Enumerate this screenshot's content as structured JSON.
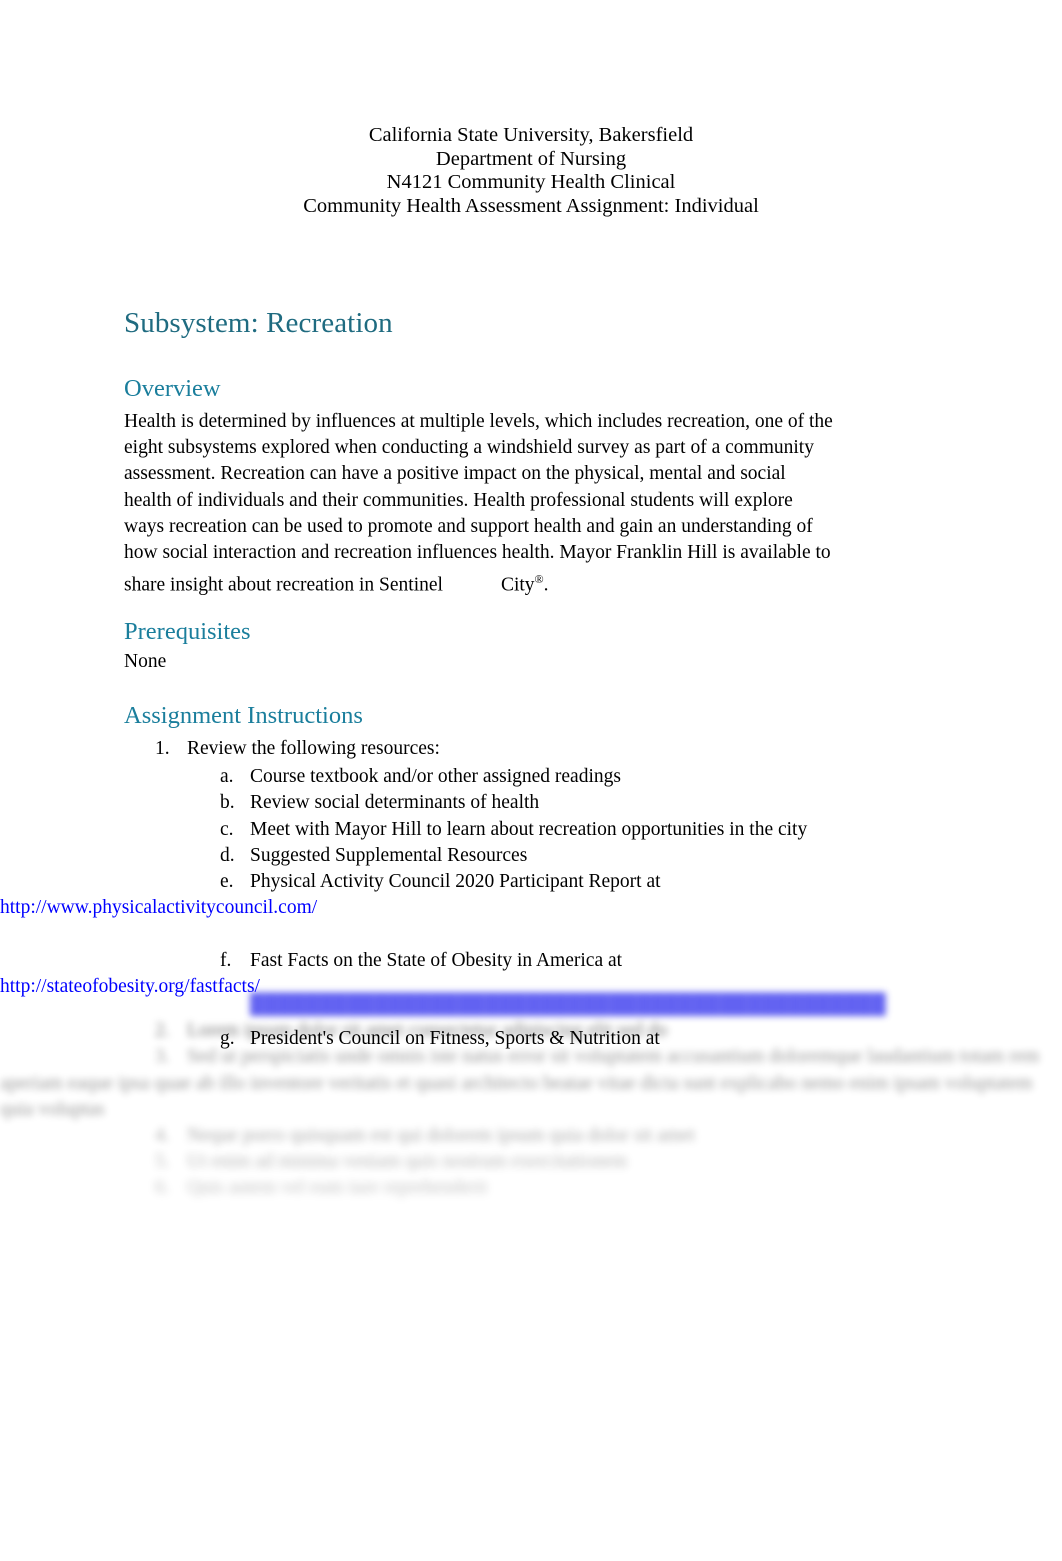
{
  "document": {
    "header_lines": [
      "California State University, Bakersfield",
      "Department of Nursing",
      "N4121 Community Health Clinical",
      "Community Health Assessment Assignment: Individual"
    ],
    "title": "Subsystem: Recreation",
    "accent_color": "#1F6B80",
    "heading_color": "#1A7E9C",
    "link_color": "#0000FF"
  },
  "overview": {
    "heading": "Overview",
    "text_part1": "Health is determined by influences at multiple levels, which includes recreation, one of the eight subsystems explored when conducting a windshield survey as part of a community assessment. Recreation can have a positive impact on the physical, mental and social health of individuals and their communities. Health professional students will explore ways recreation can be used to promote and support health and gain an understanding of how social interaction and recreation influences health. Mayor Franklin Hill is available to share insight about recreation in Sentinel",
    "text_city": "City",
    "registered_mark": "®",
    "text_end": "."
  },
  "prerequisites": {
    "heading": "Prerequisites",
    "body": "None"
  },
  "instructions": {
    "heading": "Assignment Instructions",
    "items": [
      {
        "marker": "1.",
        "text": "Review the following resources:",
        "sub_items": [
          {
            "marker": "a.",
            "text": "Course textbook and/or other assigned readings",
            "url": ""
          },
          {
            "marker": "b.",
            "text": "Review social determinants of health",
            "url": ""
          },
          {
            "marker": "c.",
            "text": "Meet with Mayor Hill to learn about recreation opportunities in the city",
            "url": ""
          },
          {
            "marker": "d.",
            "text": "Suggested Supplemental Resources",
            "url": ""
          },
          {
            "marker": "e.",
            "text": "Physical Activity Council 2020 Participant Report at",
            "url": "http://www.physicalactivitycouncil.com/"
          },
          {
            "marker": "f.",
            "text": "Fast Facts on the State of Obesity in America at",
            "url": "http://stateofobesity.org/fastfacts/"
          },
          {
            "marker": "g.",
            "text": "President's Council on Fitness, Sports & Nutrition at",
            "url": ""
          }
        ]
      }
    ]
  },
  "obscured_tail": {
    "note_visible_as": "blurred-illegible",
    "lines": [
      {
        "tier": 0,
        "marker": "",
        "indent": "sub",
        "is_url": true,
        "text": "██████████████████████████████████████████████"
      },
      {
        "tier": 1,
        "marker": "2.",
        "indent": "main",
        "is_url": false,
        "text": "Lorem ipsum dolor sit amet consectetur adipiscing elit sed do"
      },
      {
        "tier": 2,
        "marker": "3.",
        "indent": "main",
        "is_url": false,
        "text": "Sed ut perspiciatis unde omnis iste natus error sit voluptatem accusantium doloremque laudantium totam rem aperiam eaque ipsa quae ab illo inventore veritatis et quasi architecto beatae vitae dicta sunt explicabo nemo enim ipsam voluptatem quia voluptas"
      },
      {
        "tier": 3,
        "marker": "4.",
        "indent": "main",
        "is_url": false,
        "text": "Neque porro quisquam est qui dolorem ipsum quia dolor sit amet"
      },
      {
        "tier": 4,
        "marker": "5.",
        "indent": "main",
        "is_url": false,
        "text": "Ut enim ad minima veniam quis nostrum exercitationem"
      },
      {
        "tier": 5,
        "marker": "6.",
        "indent": "main",
        "is_url": false,
        "text": "Quis autem vel eum iure reprehenderit"
      }
    ]
  }
}
